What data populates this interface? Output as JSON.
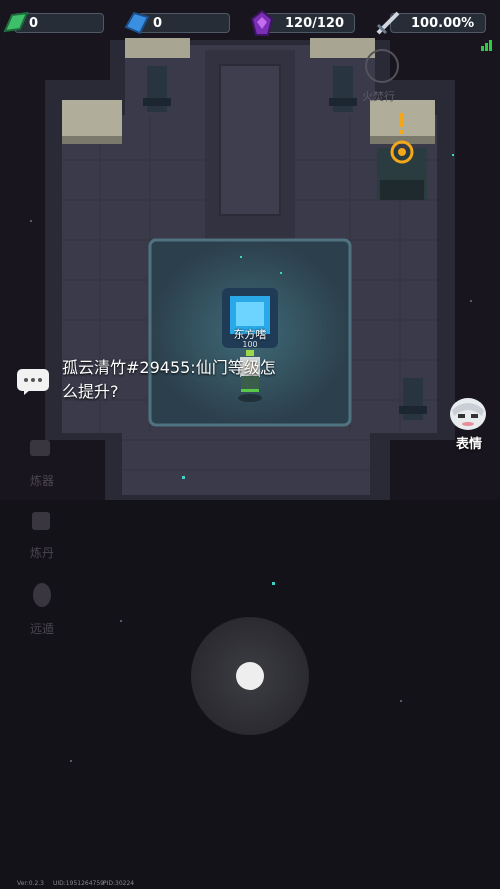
{
  "hud": {
    "jade_value": "0",
    "crystal_value": "0",
    "energy_value": "120/120",
    "percent_value": "100.00%"
  },
  "chat": {
    "message": "孤云清竹#29455:仙门等级怎么提升?"
  },
  "npc": {
    "name": "东方嗜",
    "level": "100"
  },
  "emote": {
    "label": "表情"
  },
  "skill": {
    "label": "火焚行"
  },
  "side_menu": [
    {
      "label": "炼器",
      "icon": "cauldron-icon"
    },
    {
      "label": "炼丹",
      "icon": "pill-icon"
    },
    {
      "label": "远遁",
      "icon": "gourd-icon"
    }
  ],
  "footer": {
    "version": "Ver:0.2.3",
    "uid": "UID:1951264759",
    "pid": "PID:30224"
  },
  "colors": {
    "hud_bg": "#283038",
    "portal_glow": "#2aa8e8",
    "quest_marker": "#f2a81a"
  }
}
